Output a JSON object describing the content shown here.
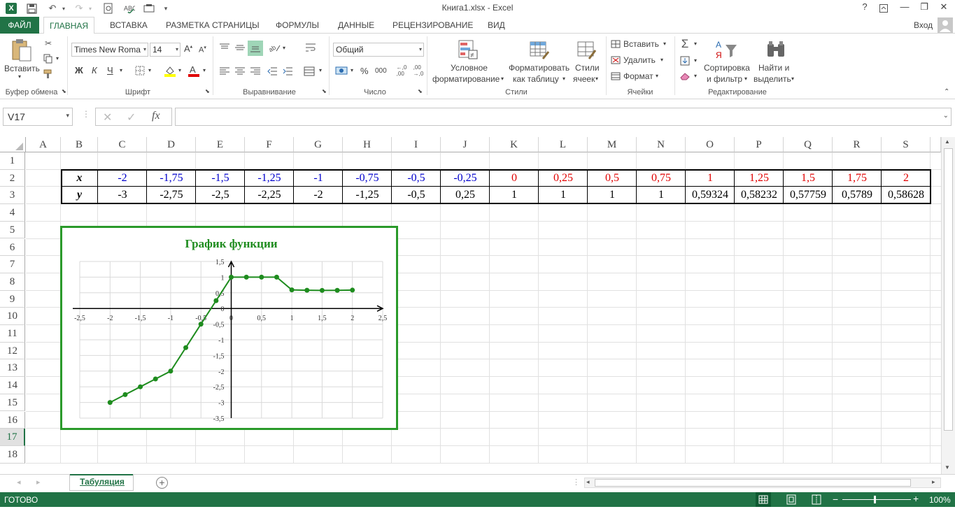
{
  "window": {
    "title": "Книга1.xlsx - Excel",
    "help": "?",
    "minimize": "—",
    "restore": "❐",
    "close": "✕"
  },
  "tabs": [
    "ФАЙЛ",
    "ГЛАВНАЯ",
    "ВСТАВКА",
    "РАЗМЕТКА СТРАНИЦЫ",
    "ФОРМУЛЫ",
    "ДАННЫЕ",
    "РЕЦЕНЗИРОВАНИЕ",
    "ВИД"
  ],
  "signin": "Вход",
  "ribbon": {
    "clipboard": {
      "label": "Буфер обмена",
      "paste": "Вставить"
    },
    "font": {
      "label": "Шрифт",
      "name": "Times New Roma",
      "size": "14",
      "bold": "Ж",
      "italic": "К",
      "underline": "Ч"
    },
    "alignment": {
      "label": "Выравнивание"
    },
    "number": {
      "label": "Число",
      "format": "Общий",
      "percent": "%",
      "thousands": "000"
    },
    "styles": {
      "label": "Стили",
      "conditional_1": "Условное",
      "conditional_2": "форматирование",
      "table_1": "Форматировать",
      "table_2": "как таблицу",
      "cells_1": "Стили",
      "cells_2": "ячеек"
    },
    "cells": {
      "label": "Ячейки",
      "insert": "Вставить",
      "delete": "Удалить",
      "format": "Формат"
    },
    "editing": {
      "label": "Редактирование",
      "sort_1": "Сортировка",
      "sort_2": "и фильтр",
      "find_1": "Найти и",
      "find_2": "выделить"
    }
  },
  "formula_bar": {
    "name_box": "V17",
    "fx": "fx",
    "value": ""
  },
  "columns": [
    "A",
    "B",
    "C",
    "D",
    "E",
    "F",
    "G",
    "H",
    "I",
    "J",
    "K",
    "L",
    "M",
    "N",
    "O",
    "P",
    "Q",
    "R",
    "S"
  ],
  "rows": [
    "1",
    "2",
    "3",
    "4",
    "5",
    "6",
    "7",
    "8",
    "9",
    "10",
    "11",
    "12",
    "13",
    "14",
    "15",
    "16",
    "17",
    "18"
  ],
  "table": {
    "x_label": "x",
    "y_label": "y",
    "x_values": [
      "-2",
      "-1,75",
      "-1,5",
      "-1,25",
      "-1",
      "-0,75",
      "-0,5",
      "-0,25",
      "0",
      "0,25",
      "0,5",
      "0,75",
      "1",
      "1,25",
      "1,5",
      "1,75",
      "2"
    ],
    "y_values": [
      "-3",
      "-2,75",
      "-2,5",
      "-2,25",
      "-2",
      "-1,25",
      "-0,5",
      "0,25",
      "1",
      "1",
      "1",
      "1",
      "0,59324",
      "0,58232",
      "0,57759",
      "0,5789",
      "0,58628"
    ],
    "neg_color": "#0000cc",
    "pos_color": "#e00000"
  },
  "chart_data": {
    "type": "scatter",
    "title": "График функции",
    "title_color": "#1e8c1e",
    "series_color": "#1e8c1e",
    "border_color": "#2a9a2a",
    "x": [
      -2,
      -1.75,
      -1.5,
      -1.25,
      -1,
      -0.75,
      -0.5,
      -0.25,
      0,
      0.25,
      0.5,
      0.75,
      1,
      1.25,
      1.5,
      1.75,
      2
    ],
    "series": [
      {
        "values": [
          -3,
          -2.75,
          -2.5,
          -2.25,
          -2,
          -1.25,
          -0.5,
          0.25,
          1,
          1,
          1,
          1,
          0.59324,
          0.58232,
          0.57759,
          0.5789,
          0.58628
        ]
      }
    ],
    "xlim": [
      -2.5,
      2.5
    ],
    "ylim": [
      -3.5,
      1.5
    ],
    "x_ticks": [
      "-2,5",
      "-2",
      "-1,5",
      "-1",
      "-0,5",
      "0",
      "0,5",
      "1",
      "1,5",
      "2",
      "2,5"
    ],
    "y_ticks": [
      "1,5",
      "1",
      "0,5",
      "0",
      "-0,5",
      "-1",
      "-1,5",
      "-2",
      "-2,5",
      "-3",
      "-3,5"
    ],
    "grid": true,
    "legend": false
  },
  "sheet": {
    "tab_name": "Табуляция"
  },
  "status": {
    "ready": "ГОТОВО",
    "zoom": "100%"
  }
}
